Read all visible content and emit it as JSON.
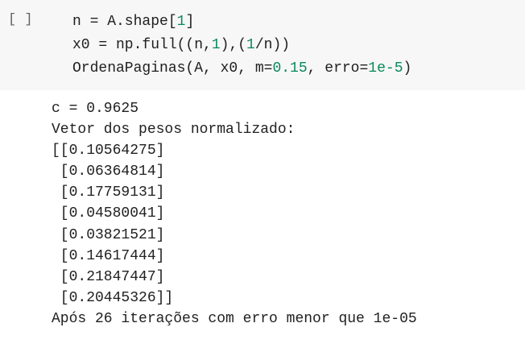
{
  "cell": {
    "run_button_label": "[ ]",
    "code_lines": [
      [
        {
          "t": "n = A.shape[",
          "k": "txt"
        },
        {
          "t": "1",
          "k": "num"
        },
        {
          "t": "]",
          "k": "txt"
        }
      ],
      [
        {
          "t": "x0 = np.full((n,",
          "k": "txt"
        },
        {
          "t": "1",
          "k": "num"
        },
        {
          "t": "),(",
          "k": "txt"
        },
        {
          "t": "1",
          "k": "num"
        },
        {
          "t": "/n))",
          "k": "txt"
        }
      ],
      [
        {
          "t": "OrdenaPaginas(A, x0, m=",
          "k": "txt"
        },
        {
          "t": "0.15",
          "k": "num"
        },
        {
          "t": ", erro=",
          "k": "txt"
        },
        {
          "t": "1e-5",
          "k": "num"
        },
        {
          "t": ")",
          "k": "txt"
        }
      ]
    ]
  },
  "output": {
    "lines": [
      "c = 0.9625",
      "Vetor dos pesos normalizado:",
      "[[0.10564275]",
      " [0.06364814]",
      " [0.17759131]",
      " [0.04580041]",
      " [0.03821521]",
      " [0.14617444]",
      " [0.21847447]",
      " [0.20445326]]",
      "Após 26 iterações com erro menor que 1e-05"
    ]
  },
  "colors": {
    "cell_background": "#f7f7f7",
    "number_literal": "#09885a",
    "code_text": "#202020",
    "output_text": "#212121"
  }
}
